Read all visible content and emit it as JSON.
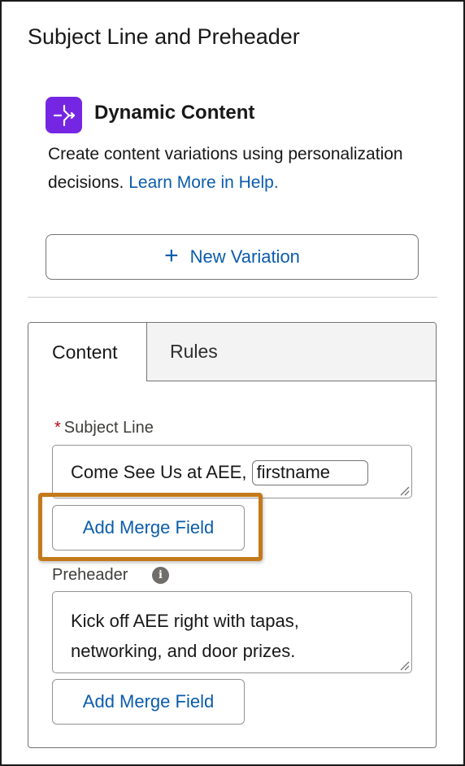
{
  "panel": {
    "title": "Subject Line and Preheader"
  },
  "dynamic_content": {
    "icon": "dynamic-content-icon",
    "icon_color": "#7526E3",
    "title": "Dynamic Content",
    "description": "Create content variations using personalization decisions.",
    "link_text": "Learn More in Help.",
    "new_variation_label": "New Variation"
  },
  "tabs": [
    {
      "label": "Content",
      "active": true
    },
    {
      "label": "Rules",
      "active": false
    }
  ],
  "subject": {
    "label": "Subject Line",
    "required_marker": "*",
    "text": "Come See Us at AEE,",
    "merge_token": "firstname",
    "add_merge_label": "Add Merge Field"
  },
  "preheader": {
    "label": "Preheader",
    "info_icon": "info-icon",
    "text": "Kick off AEE right with tapas, networking, and door prizes.",
    "add_merge_label": "Add Merge Field"
  },
  "colors": {
    "link": "#0B5CAB",
    "highlight": "#C47A1A",
    "required": "#BA0517"
  }
}
